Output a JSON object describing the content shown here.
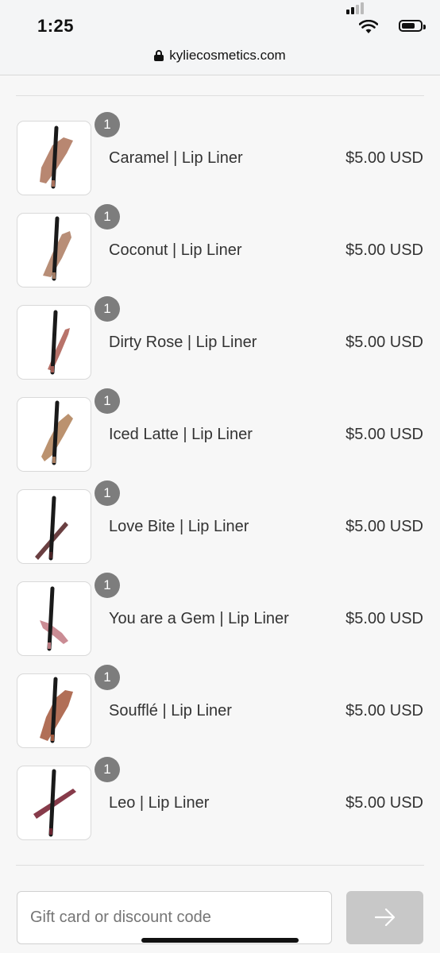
{
  "status_bar": {
    "time": "1:25",
    "icons": [
      "signal-icon",
      "wifi-icon",
      "battery-icon"
    ]
  },
  "browser": {
    "url": "kyliecosmetics.com",
    "icon": "lock-icon"
  },
  "products": [
    {
      "name": "Caramel | Lip Liner",
      "price": "$5.00 USD",
      "quantity": "1",
      "swatch_color": "#b07a62",
      "pencil_color": "#a8705b"
    },
    {
      "name": "Coconut | Lip Liner",
      "price": "$5.00 USD",
      "quantity": "1",
      "swatch_color": "#b08268",
      "pencil_color": "#a07a62"
    },
    {
      "name": "Dirty Rose | Lip Liner",
      "price": "$5.00 USD",
      "quantity": "1",
      "swatch_color": "#b0645a",
      "pencil_color": "#a05a52"
    },
    {
      "name": "Iced Latte | Lip Liner",
      "price": "$5.00 USD",
      "quantity": "1",
      "swatch_color": "#b4865f",
      "pencil_color": "#a87e60"
    },
    {
      "name": "Love Bite | Lip Liner",
      "price": "$5.00 USD",
      "quantity": "1",
      "swatch_color": "#5a2a2c",
      "pencil_color": "#4a2426"
    },
    {
      "name": "You are a Gem | Lip Liner",
      "price": "$5.00 USD",
      "quantity": "1",
      "swatch_color": "#c48088",
      "pencil_color": "#b87a80"
    },
    {
      "name": "Soufflé | Lip Liner",
      "price": "$5.00 USD",
      "quantity": "1",
      "swatch_color": "#a85f45",
      "pencil_color": "#a05a40"
    },
    {
      "name": "Leo | Lip Liner",
      "price": "$5.00 USD",
      "quantity": "1",
      "swatch_color": "#7a2636",
      "pencil_color": "#6a2430"
    }
  ],
  "discount": {
    "placeholder": "Gift card or discount code",
    "apply_icon": "arrow-right-icon"
  },
  "colors": {
    "badge": "#7d7d7d",
    "apply_button_disabled": "#c8c8c8",
    "background": "#f7f7f7"
  }
}
